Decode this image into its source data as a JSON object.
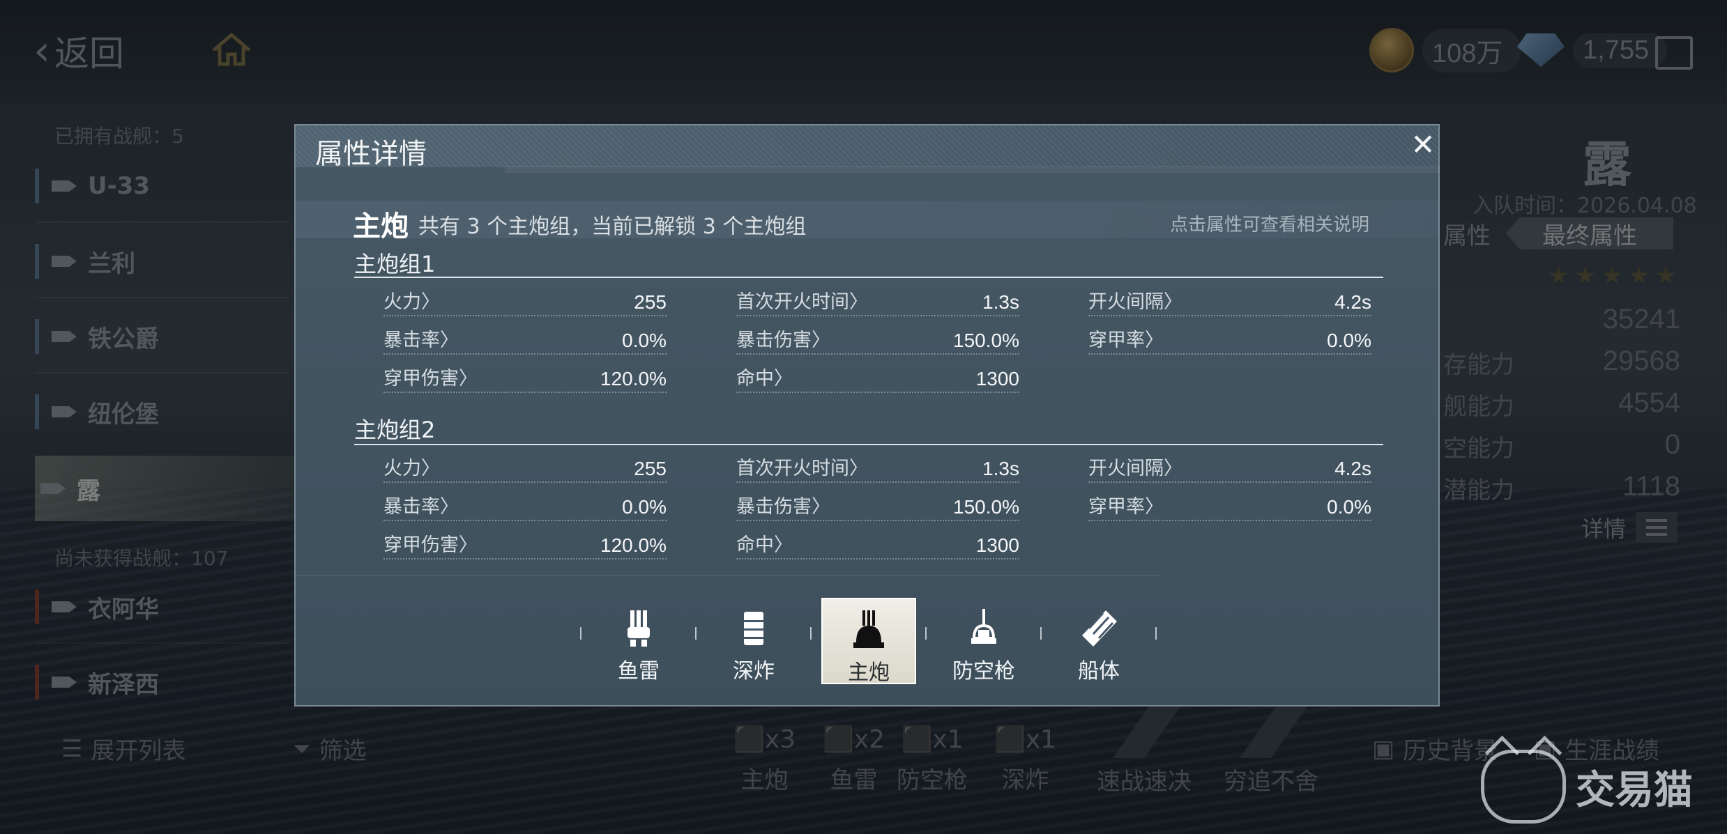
{
  "topbar": {
    "back_label": "返回",
    "gold": "108万",
    "diamond": "1,755"
  },
  "ships": {
    "owned_label": "已拥有战舰：5",
    "unowned_label": "尚未获得战舰：107",
    "owned": [
      "U-33",
      "兰利",
      "铁公爵",
      "纽伦堡",
      "露"
    ],
    "unowned": [
      "衣阿华",
      "新泽西"
    ]
  },
  "right_panel": {
    "ship_name": "露",
    "join_time": "入队时间：2026.04.08",
    "tab_attr": "属性",
    "tab_final": "最终属性",
    "stars": "★★★★★",
    "rows": [
      {
        "label": "",
        "value": "35241"
      },
      {
        "label": "存能力",
        "value": "29568"
      },
      {
        "label": "舰能力",
        "value": "4554"
      },
      {
        "label": "空能力",
        "value": "0"
      },
      {
        "label": "潜能力",
        "value": "1118"
      }
    ],
    "detail_label": "详情"
  },
  "bottom": {
    "expand_list": "展开列表",
    "filter": "筛选",
    "equip": [
      {
        "label": "主炮",
        "count": "x3"
      },
      {
        "label": "鱼雷",
        "count": "x2"
      },
      {
        "label": "防空枪",
        "count": "x1"
      },
      {
        "label": "深炸",
        "count": "x1"
      }
    ],
    "skill1": "速战速决",
    "skill2": "穷追不舍",
    "history": "历史背景",
    "career": "生涯战绩",
    "watermark": "交易猫"
  },
  "modal": {
    "title": "属性详情",
    "close": "✕",
    "section_name": "主炮",
    "section_desc": "共有 3 个主炮组，当前已解锁 3 个主炮组",
    "section_hint": "点击属性可查看相关说明",
    "groups": [
      {
        "title": "主炮组1",
        "stats": [
          {
            "label": "火力〉",
            "value": "255"
          },
          {
            "label": "首次开火时间〉",
            "value": "1.3s"
          },
          {
            "label": "开火间隔〉",
            "value": "4.2s"
          },
          {
            "label": "暴击率〉",
            "value": "0.0%"
          },
          {
            "label": "暴击伤害〉",
            "value": "150.0%"
          },
          {
            "label": "穿甲率〉",
            "value": "0.0%"
          },
          {
            "label": "穿甲伤害〉",
            "value": "120.0%"
          },
          {
            "label": "命中〉",
            "value": "1300"
          }
        ]
      },
      {
        "title": "主炮组2",
        "stats": [
          {
            "label": "火力〉",
            "value": "255"
          },
          {
            "label": "首次开火时间〉",
            "value": "1.3s"
          },
          {
            "label": "开火间隔〉",
            "value": "4.2s"
          },
          {
            "label": "暴击率〉",
            "value": "0.0%"
          },
          {
            "label": "暴击伤害〉",
            "value": "150.0%"
          },
          {
            "label": "穿甲率〉",
            "value": "0.0%"
          },
          {
            "label": "穿甲伤害〉",
            "value": "120.0%"
          },
          {
            "label": "命中〉",
            "value": "1300"
          }
        ]
      }
    ],
    "tabs": [
      {
        "label": "鱼雷",
        "icon": "torpedo-icon"
      },
      {
        "label": "深炸",
        "icon": "depth-charge-icon"
      },
      {
        "label": "主炮",
        "icon": "main-gun-icon",
        "active": true
      },
      {
        "label": "防空枪",
        "icon": "anti-air-icon"
      },
      {
        "label": "船体",
        "icon": "hull-icon"
      }
    ]
  }
}
